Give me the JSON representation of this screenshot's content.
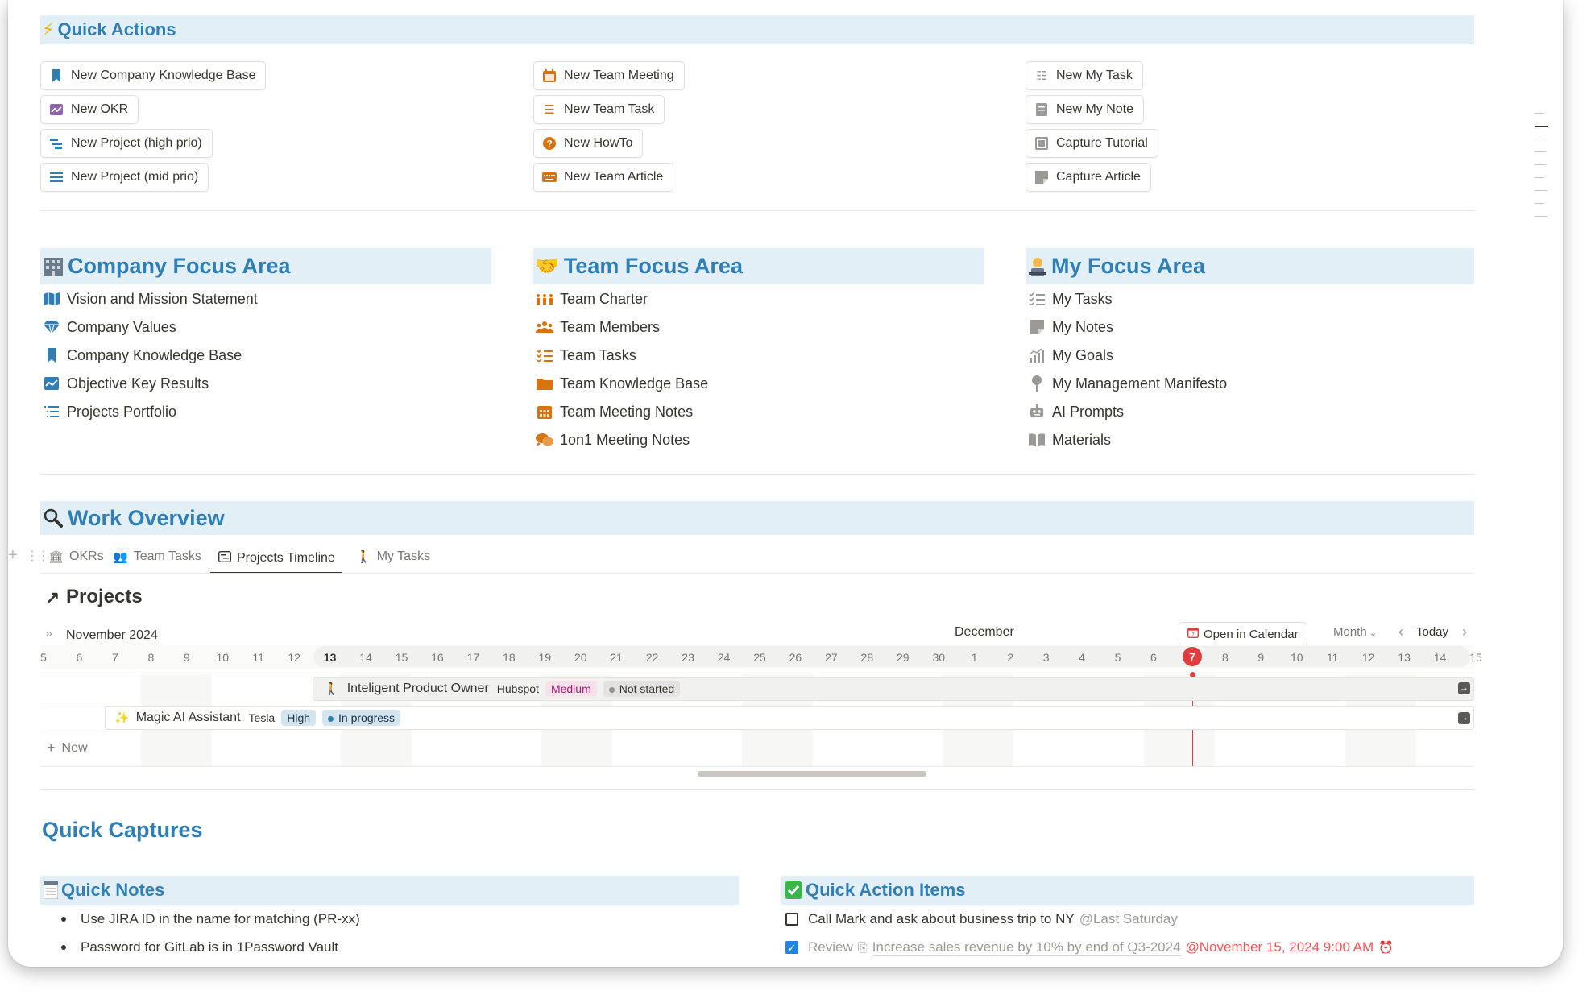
{
  "quick_actions": {
    "title": "Quick Actions",
    "icon": "lightning-icon",
    "buttons": [
      {
        "label": "New Company Knowledge Base",
        "icon": "bookmark-icon"
      },
      {
        "label": "New OKR",
        "icon": "chart-icon"
      },
      {
        "label": "New Project (high prio)",
        "icon": "timeline-bars-icon"
      },
      {
        "label": "New Project (mid prio)",
        "icon": "menu-lines-icon"
      },
      {
        "label": "New Team Meeting",
        "icon": "calendar-icon"
      },
      {
        "label": "New Team Task",
        "icon": "checklist-icon"
      },
      {
        "label": "New HowTo",
        "icon": "question-icon"
      },
      {
        "label": "New Team Article",
        "icon": "keyboard-icon"
      },
      {
        "label": "New My Task",
        "icon": "checklist-icon"
      },
      {
        "label": "New My Note",
        "icon": "note-icon"
      },
      {
        "label": "Capture Tutorial",
        "icon": "video-icon"
      },
      {
        "label": "Capture Article",
        "icon": "sticky-note-icon"
      }
    ]
  },
  "company_focus": {
    "title": "Company Focus Area",
    "icon": "office-building-icon",
    "items": [
      {
        "label": "Vision and Mission Statement",
        "icon": "map-icon"
      },
      {
        "label": "Company Values",
        "icon": "diamond-icon"
      },
      {
        "label": "Company Knowledge Base",
        "icon": "bookmark-icon"
      },
      {
        "label": "Objective Key Results",
        "icon": "chart-icon"
      },
      {
        "label": "Projects Portfolio",
        "icon": "list-indent-icon"
      }
    ]
  },
  "team_focus": {
    "title": "Team Focus Area",
    "icon": "handshake-icon",
    "items": [
      {
        "label": "Team Charter",
        "icon": "people-row-icon"
      },
      {
        "label": "Team Members",
        "icon": "group-icon"
      },
      {
        "label": "Team Tasks",
        "icon": "checklist-icon"
      },
      {
        "label": "Team Knowledge Base",
        "icon": "folder-icon"
      },
      {
        "label": "Team Meeting Notes",
        "icon": "calendar-icon"
      },
      {
        "label": "1on1 Meeting Notes",
        "icon": "chat-bubbles-icon"
      }
    ]
  },
  "my_focus": {
    "title": "My Focus Area",
    "icon": "person-at-desk-icon",
    "items": [
      {
        "label": "My Tasks",
        "icon": "checklist-icon"
      },
      {
        "label": "My Notes",
        "icon": "note-icon"
      },
      {
        "label": "My Goals",
        "icon": "chart-climb-icon"
      },
      {
        "label": "My Management Manifesto",
        "icon": "pin-icon"
      },
      {
        "label": "AI Prompts",
        "icon": "robot-icon"
      },
      {
        "label": "Materials",
        "icon": "book-icon"
      }
    ]
  },
  "work_overview": {
    "title": "Work Overview",
    "icon": "magnifier-icon",
    "tabs": [
      {
        "label": "OKRs",
        "icon": "bank-icon"
      },
      {
        "label": "Team Tasks",
        "icon": "group-icon"
      },
      {
        "label": "Projects Timeline",
        "icon": "timeline-icon"
      },
      {
        "label": "My Tasks",
        "icon": "walking-icon"
      }
    ],
    "active_tab": "Projects Timeline"
  },
  "timeline": {
    "title": "Projects",
    "month_left": "November 2024",
    "month_mid": "December",
    "open_calendar": "Open in Calendar",
    "scale": "Month",
    "today_label": "Today",
    "today_day": "7",
    "days": [
      "5",
      "6",
      "7",
      "8",
      "9",
      "10",
      "11",
      "12",
      "13",
      "14",
      "15",
      "16",
      "17",
      "18",
      "19",
      "20",
      "21",
      "22",
      "23",
      "24",
      "25",
      "26",
      "27",
      "28",
      "29",
      "30",
      "1",
      "2",
      "3",
      "4",
      "5",
      "6",
      "7",
      "8",
      "9",
      "10",
      "11",
      "12",
      "13",
      "14",
      "15"
    ],
    "rows": [
      {
        "name": "Inteligent Product Owner",
        "company": "Hubspot",
        "priority": "Medium",
        "status": "Not started"
      },
      {
        "name": "Magic AI Assistant",
        "company": "Tesla",
        "priority": "High",
        "status": "In progress"
      }
    ],
    "new_label": "New"
  },
  "quick_captures": {
    "title": "Quick Captures",
    "notes": {
      "title": "Quick Notes",
      "icon": "notepad-icon",
      "items": [
        "Use JIRA ID in the name for matching (PR-xx)",
        "Password for GitLab is in 1Password Vault"
      ]
    },
    "actions": {
      "title": "Quick Action Items",
      "icon": "check-mark-icon",
      "items": [
        {
          "text": "Call Mark and ask about business trip to NY",
          "mention": "@Last Saturday",
          "done": false
        },
        {
          "prefix": "Review",
          "link": "Increase sales revenue by 10% by end of Q3-2024",
          "mention": "@November 15, 2024 9:00 AM",
          "done": true
        }
      ]
    }
  },
  "colors": {
    "accent": "#2f7fb5",
    "banner_bg": "#e3eff7",
    "today_red": "#e03e3e",
    "icon_orange": "#d9730d",
    "icon_blue": "#2f7fb5"
  }
}
